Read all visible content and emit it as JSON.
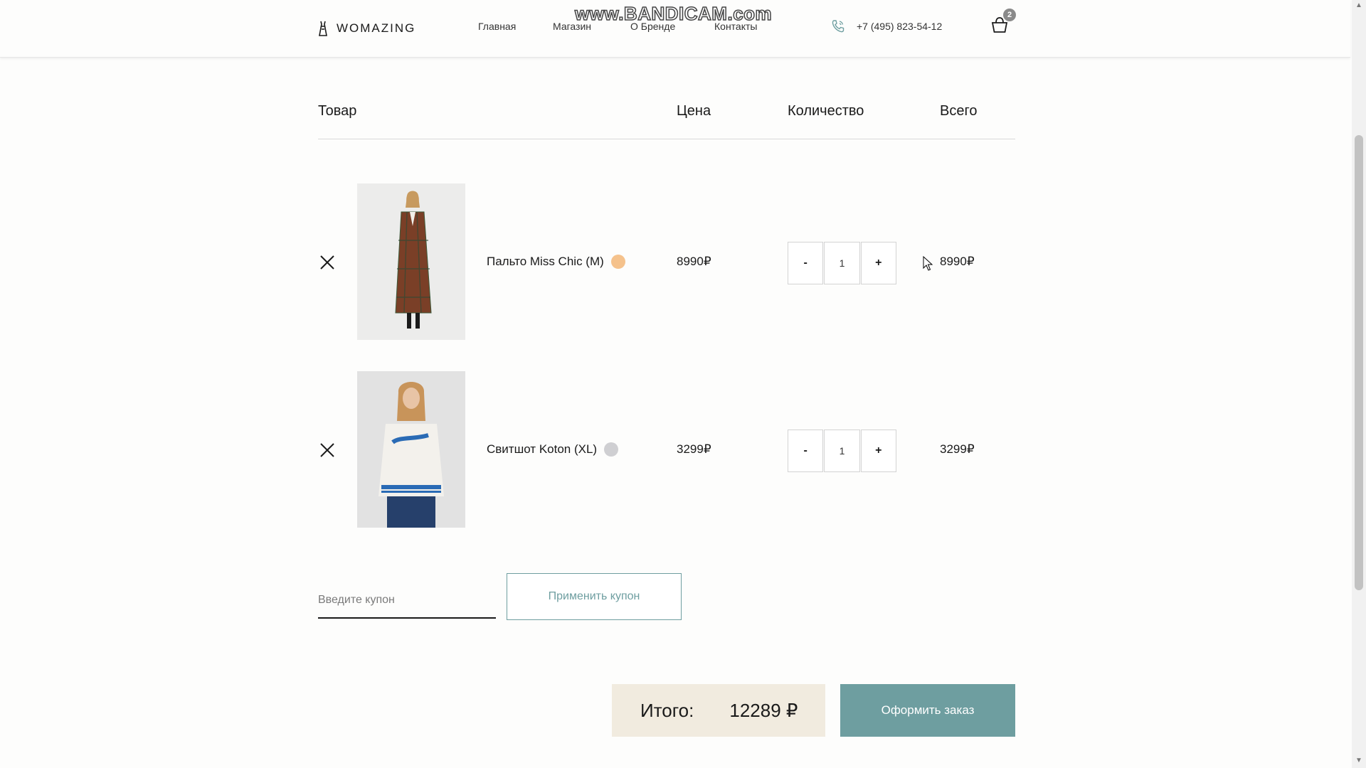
{
  "brand": {
    "name": "WOMAZING"
  },
  "watermark": "www.BANDICAM.com",
  "nav": [
    "Главная",
    "Магазин",
    "О Бренде",
    "Контакты"
  ],
  "contact": {
    "phone": "+7 (495) 823-54-12",
    "icon": "phone-icon"
  },
  "cart": {
    "count": "2",
    "icon": "cart-icon"
  },
  "table": {
    "headers": {
      "product": "Товар",
      "price": "Цена",
      "quantity": "Количество",
      "total": "Всего"
    }
  },
  "items": [
    {
      "name": "Пальто Miss Chic (M)",
      "color": "#f5c28c",
      "price": "8990₽",
      "quantity": "1",
      "total": "8990₽",
      "image": "coat-photo"
    },
    {
      "name": "Свитшот Koton (XL)",
      "color": "#cfcfd2",
      "price": "3299₽",
      "quantity": "1",
      "total": "3299₽",
      "image": "sweatshirt-photo"
    }
  ],
  "qty_buttons": {
    "minus": "-",
    "plus": "+"
  },
  "coupon": {
    "placeholder": "Введите купон",
    "apply_label": "Применить купон"
  },
  "summary": {
    "label": "Итого:",
    "amount": "12289 ₽"
  },
  "checkout_label": "Оформить заказ",
  "colors": {
    "accent": "#6e9ea0",
    "total_bg": "#f1ebdf"
  }
}
